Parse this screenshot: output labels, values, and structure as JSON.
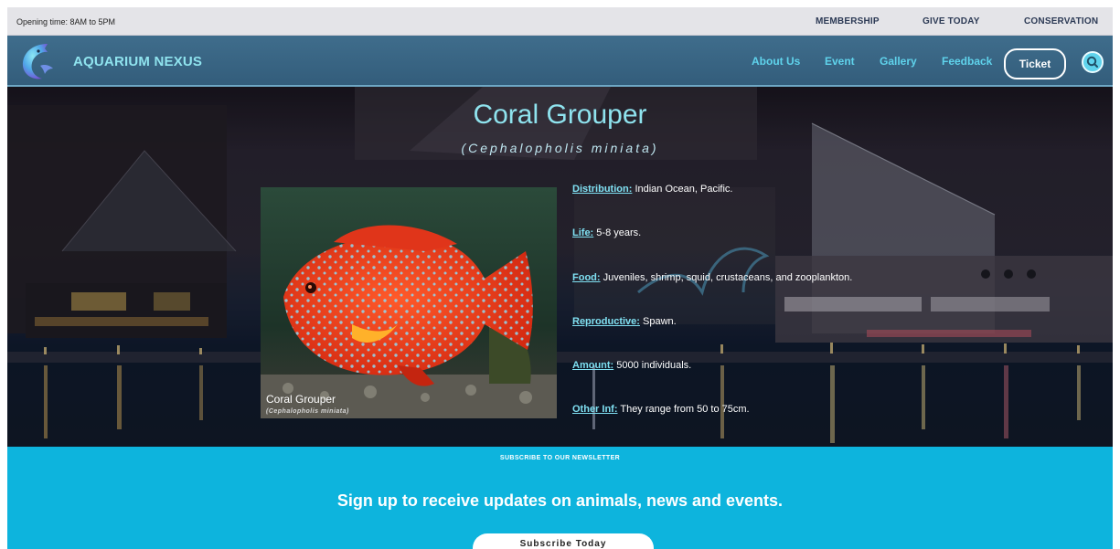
{
  "topbar": {
    "hours": "Opening time: 8AM to 5PM",
    "links": [
      "MEMBERSHIP",
      "GIVE TODAY",
      "CONSERVATION"
    ]
  },
  "navbar": {
    "brand": "AQUARIUM NEXUS",
    "links": [
      "About Us",
      "Event",
      "Gallery",
      "Feedback"
    ],
    "ticket": "Ticket",
    "search_icon": "search-icon"
  },
  "hero": {
    "title": "Coral Grouper",
    "scientific": "(Cephalopholis miniata)",
    "photo_caption": "Coral Grouper",
    "photo_caption_sci": "(Cephalopholis miniata)",
    "facts": [
      {
        "label": "Distribution:",
        "value": " Indian Ocean, Pacific."
      },
      {
        "label": "Life:",
        "value": " 5-8 years."
      },
      {
        "label": "Food:",
        "value": " Juveniles, shrimp, squid, crustaceans, and zooplankton."
      },
      {
        "label": "Reproductive:",
        "value": " Spawn."
      },
      {
        "label": "Amount:",
        "value": " 5000 individuals."
      },
      {
        "label": "Other Inf:",
        "value": " They range from 50 to 75cm."
      }
    ]
  },
  "newsletter": {
    "overline": "SUBSCRIBE TO OUR NEWSLETTER",
    "headline": "Sign up to receive updates on animals, news and events.",
    "button": "Subscribe Today"
  },
  "colors": {
    "accent": "#5fd3ec",
    "nav_bg": "#3a6785",
    "newsletter_bg": "#0db4dd"
  }
}
